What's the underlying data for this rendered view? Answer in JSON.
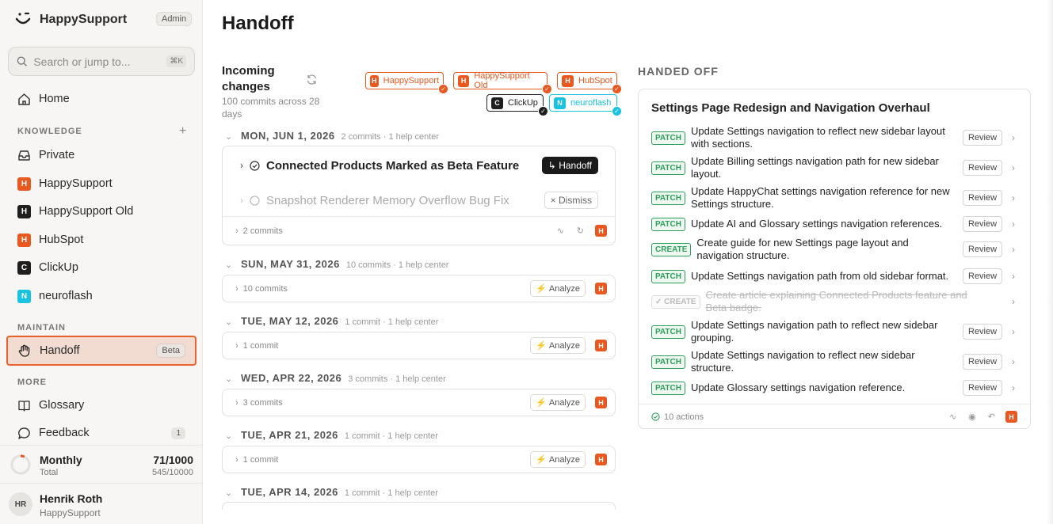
{
  "sidebar": {
    "brand": "HappySupport",
    "role_badge": "Admin",
    "search_placeholder": "Search or jump to...",
    "search_shortcut": "⌘K",
    "home": "Home",
    "knowledge_label": "KNOWLEDGE",
    "knowledge_items": [
      {
        "label": "Private",
        "icon": "inbox-icon"
      },
      {
        "label": "HappySupport",
        "letter": "H",
        "color": "#e8581f"
      },
      {
        "label": "HappySupport Old",
        "letter": "H",
        "color": "#1f1f1f"
      },
      {
        "label": "HubSpot",
        "letter": "H",
        "color": "#e8581f"
      },
      {
        "label": "ClickUp",
        "letter": "C",
        "color": "#1f1f1f"
      },
      {
        "label": "neuroflash",
        "letter": "N",
        "color": "#18c3e0"
      }
    ],
    "maintain_label": "MAINTAIN",
    "handoff": "Handoff",
    "handoff_badge": "Beta",
    "more_label": "MORE",
    "glossary": "Glossary",
    "feedback": "Feedback",
    "feedback_count": "1",
    "usage": {
      "period": "Monthly",
      "period_value": "71/1000",
      "total": "Total",
      "total_value": "545/10000",
      "fraction": 0.071
    },
    "user": {
      "initials": "HR",
      "name": "Henrik Roth",
      "org": "HappySupport"
    }
  },
  "main": {
    "title": "Handoff",
    "incoming_title": "Incoming changes",
    "incoming_sub": "100 commits across 28 days",
    "sources": [
      {
        "label": "HappySupport",
        "letter": "H",
        "color": "#e8581f"
      },
      {
        "label": "HappySupport Old",
        "letter": "H",
        "color": "#e8581f"
      },
      {
        "label": "HubSpot",
        "letter": "H",
        "color": "#e8581f"
      },
      {
        "label": "ClickUp",
        "letter": "C",
        "color": "#1f1f1f"
      },
      {
        "label": "neuroflash",
        "letter": "N",
        "color": "#18c3e0"
      }
    ],
    "days": [
      {
        "date": "MON, JUN 1, 2026",
        "meta": "2 commits · 1 help center",
        "commits": "2 commits"
      },
      {
        "date": "SUN, MAY 31, 2026",
        "meta": "10 commits · 1 help center",
        "commits": "10 commits"
      },
      {
        "date": "TUE, MAY 12, 2026",
        "meta": "1 commit · 1 help center",
        "commits": "1 commit"
      },
      {
        "date": "WED, APR 22, 2026",
        "meta": "3 commits · 1 help center",
        "commits": "3 commits"
      },
      {
        "date": "TUE, APR 21, 2026",
        "meta": "1 commit · 1 help center",
        "commits": "1 commit"
      },
      {
        "date": "TUE, APR 14, 2026",
        "meta": "1 commit · 1 help center",
        "commits": ""
      }
    ],
    "first_day_items": [
      {
        "title": "Connected Products Marked as Beta Feature",
        "action": "Handoff"
      },
      {
        "title": "Snapshot Renderer Memory Overflow Bug Fix",
        "action": "Dismiss"
      }
    ],
    "analyze_label": "Analyze",
    "handed_off_label": "HANDED OFF",
    "handed_card": {
      "title": "Settings Page Redesign and Navigation Overhaul",
      "review_label": "Review",
      "actions": [
        {
          "tag": "PATCH",
          "text": "Update Settings navigation to reflect new sidebar layout with sections."
        },
        {
          "tag": "PATCH",
          "text": "Update Billing settings navigation path for new sidebar layout."
        },
        {
          "tag": "PATCH",
          "text": "Update HappyChat settings navigation reference for new Settings structure."
        },
        {
          "tag": "PATCH",
          "text": "Update AI and Glossary settings navigation references."
        },
        {
          "tag": "CREATE",
          "text": "Create guide for new Settings page layout and navigation structure."
        },
        {
          "tag": "PATCH",
          "text": "Update Settings navigation path from old sidebar format."
        },
        {
          "tag": "✓ CREATE",
          "text": "Create article explaining Connected Products feature and Beta badge."
        },
        {
          "tag": "PATCH",
          "text": "Update Settings navigation path to reflect new sidebar grouping."
        },
        {
          "tag": "PATCH",
          "text": "Update Settings navigation to reflect new sidebar structure."
        },
        {
          "tag": "PATCH",
          "text": "Update Glossary settings navigation reference."
        }
      ],
      "footer": "10 actions"
    }
  }
}
